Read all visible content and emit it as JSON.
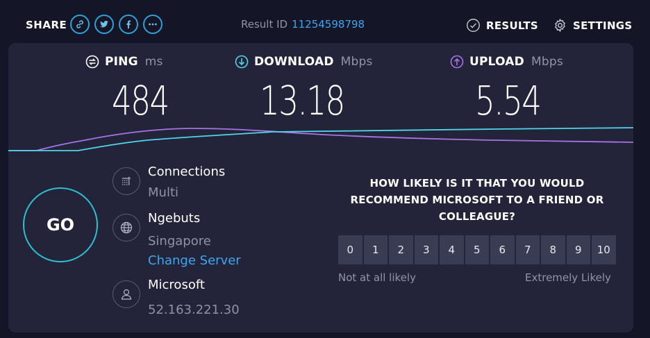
{
  "header": {
    "share_label": "SHARE",
    "share_icons": [
      "link-icon",
      "twitter-icon",
      "facebook-icon",
      "more-icon"
    ],
    "result_id_label": "Result ID",
    "result_id_value": "11254598798",
    "results_label": "RESULTS",
    "settings_label": "SETTINGS"
  },
  "metrics": {
    "ping": {
      "label": "PING",
      "unit": "ms",
      "value": "484"
    },
    "download": {
      "label": "DOWNLOAD",
      "unit": "Mbps",
      "value": "13.18"
    },
    "upload": {
      "label": "UPLOAD",
      "unit": "Mbps",
      "value": "5.54"
    }
  },
  "go_label": "GO",
  "connection": {
    "title": "Connections",
    "value": "Multi"
  },
  "server": {
    "name": "Ngebuts",
    "location": "Singapore",
    "change_label": "Change Server"
  },
  "host": {
    "provider": "Microsoft",
    "ip": "52.163.221.30"
  },
  "survey": {
    "question": "HOW LIKELY IS IT THAT YOU WOULD RECOMMEND MICROSOFT TO A FRIEND OR COLLEAGUE?",
    "scale": [
      "0",
      "1",
      "2",
      "3",
      "4",
      "5",
      "6",
      "7",
      "8",
      "9",
      "10"
    ],
    "low_label": "Not at all likely",
    "high_label": "Extremely Likely"
  },
  "colors": {
    "background": "#141526",
    "card": "#23243a",
    "accent_blue": "#3ea6ee",
    "download_line": "#4fd6e8",
    "upload_line": "#a773e6"
  }
}
